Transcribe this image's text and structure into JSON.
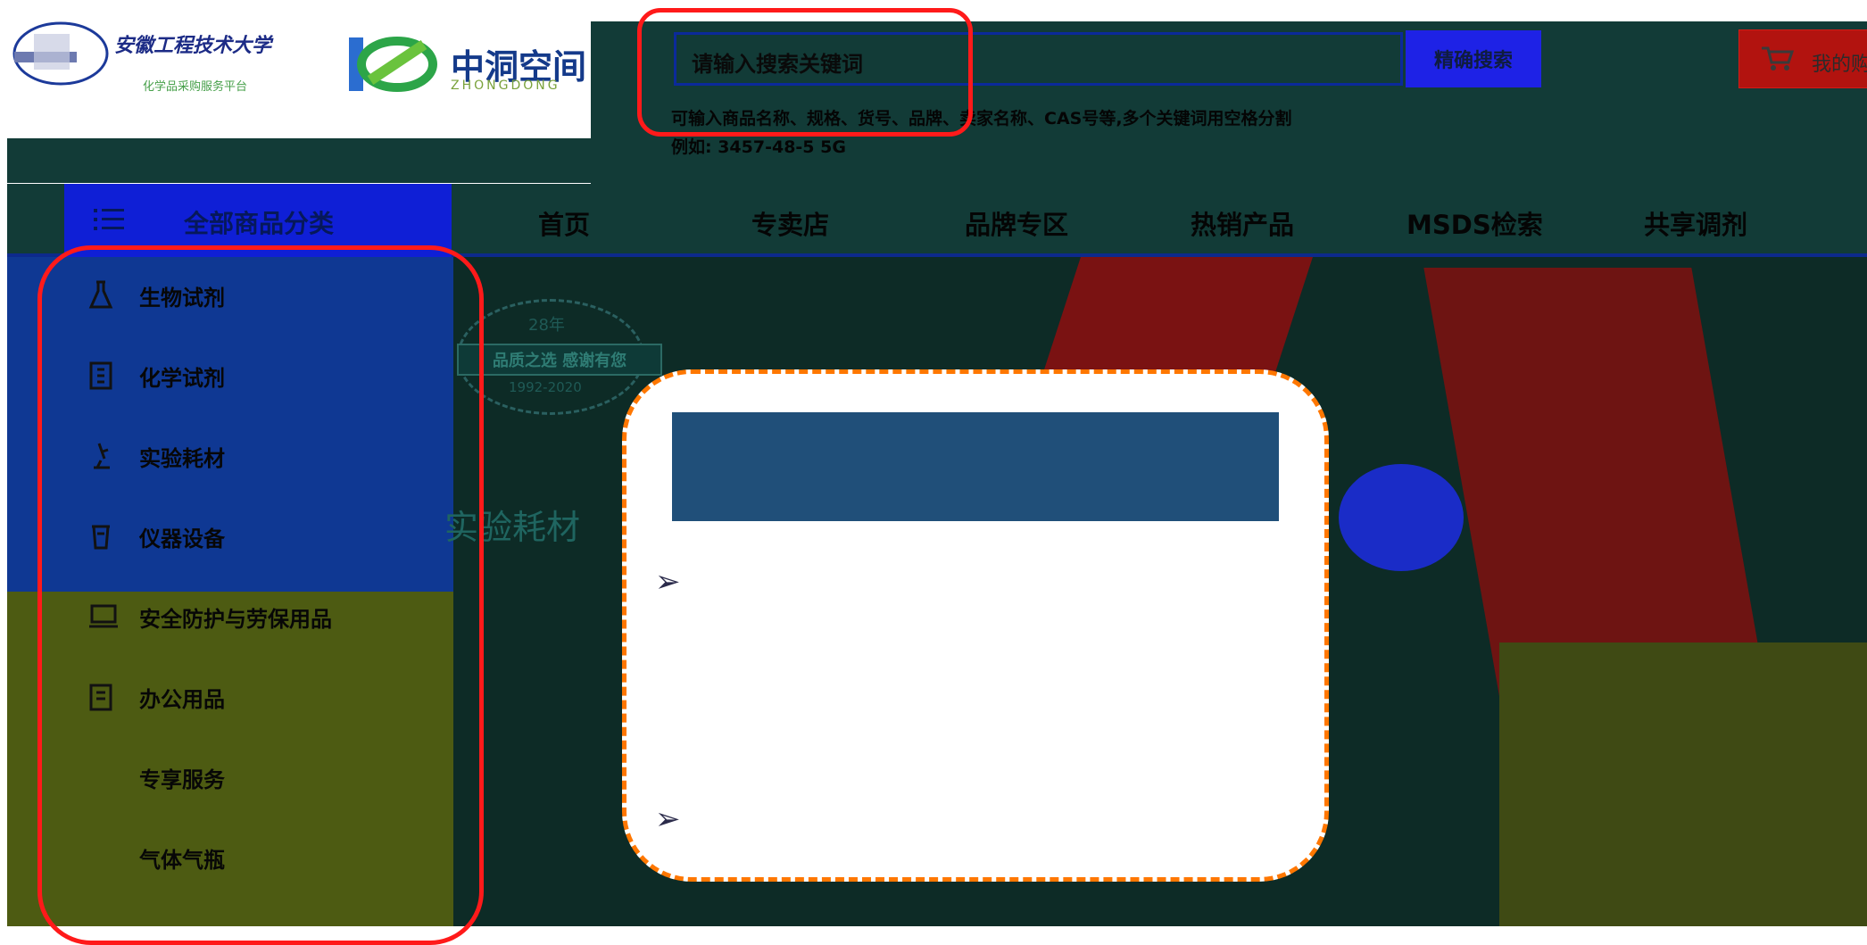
{
  "header": {
    "university_name": "安徽工程技术大学",
    "university_sub": "化学品采购服务平台",
    "brand_name": "中洞空间",
    "brand_sub": "ZHONGDONG",
    "search_placeholder": "请输入搜索关键词",
    "search_button": "精确搜索",
    "search_hint": "可输入商品名称、规格、货号、品牌、卖家名称、CAS号等,多个关键词用空格分割",
    "search_example": "例如: 3457-48-5 5G",
    "cart_label": "我的购物车"
  },
  "nav": {
    "category_label": "全部商品分类",
    "items": [
      "首页",
      "专卖店",
      "品牌专区",
      "热销产品",
      "MSDS检索",
      "共享调剂"
    ]
  },
  "sidebar": {
    "items": [
      {
        "label": "生物试剂",
        "icon": "flask-icon"
      },
      {
        "label": "化学试剂",
        "icon": "document-icon"
      },
      {
        "label": "实验耗材",
        "icon": "microscope-icon"
      },
      {
        "label": "仪器设备",
        "icon": "instrument-icon"
      },
      {
        "label": "安全防护与劳保用品",
        "icon": "laptop-icon"
      },
      {
        "label": "办公用品",
        "icon": "clipboard-icon"
      },
      {
        "label": "专享服务",
        "icon": ""
      },
      {
        "label": "气体气瓶",
        "icon": ""
      }
    ]
  },
  "banner": {
    "badge_top": "28年",
    "badge_mid": "品质之选 感谢有您",
    "badge_bottom": "1992-2020",
    "text": "实验耗材"
  },
  "callout": {
    "bullets": [
      "➢",
      "➢"
    ]
  },
  "colors": {
    "header_bg": "#123b37",
    "nav_category_bg": "#0f1fd6",
    "cart_bg": "#b2130f",
    "annotation_red": "#ff1a1a",
    "callout_border": "#ff7700",
    "callout_header": "#204f79"
  }
}
